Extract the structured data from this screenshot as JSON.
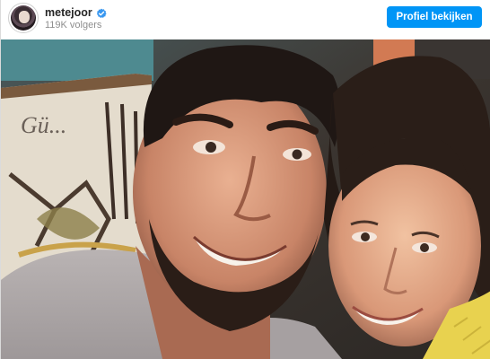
{
  "post": {
    "username": "metejoor",
    "followers": "119K volgers",
    "profile_button_label": "Profiel bekijken",
    "verified": true,
    "verified_badge_color": "#3897f0",
    "button_color": "#0095f6"
  },
  "photo": {
    "wall_text": "Gü..."
  }
}
